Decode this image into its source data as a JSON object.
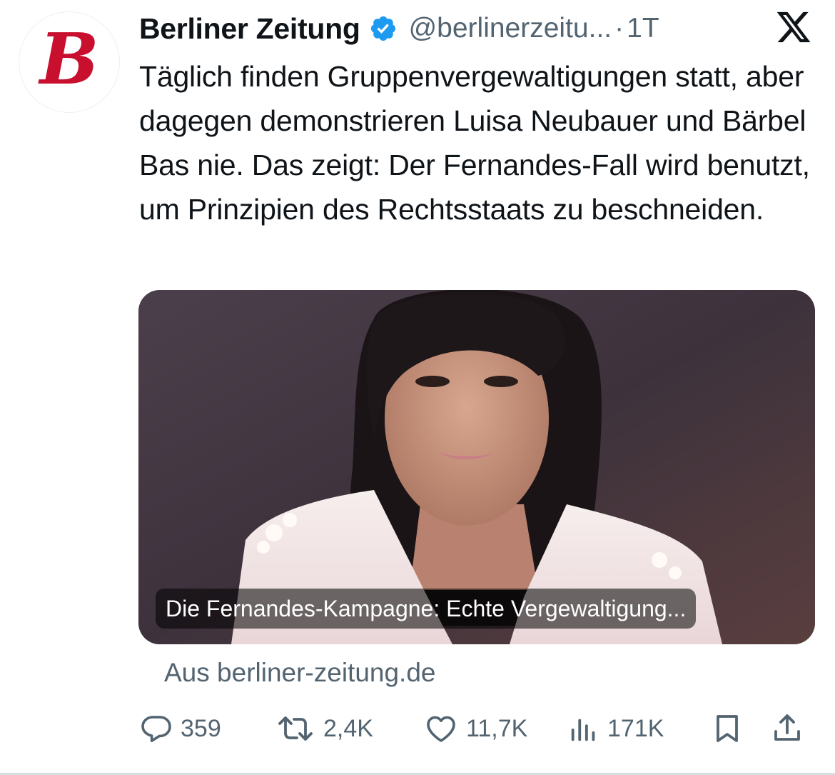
{
  "author": {
    "name": "Berliner Zeitung",
    "handle": "@berlinerzeitu...",
    "separator": "·",
    "time": "1T",
    "avatar_letter": "B",
    "verified_icon": "verified-badge-icon"
  },
  "platform_logo": "x-logo",
  "tweet_text": "Täglich finden Gruppenvergewaltigungen statt, aber dagegen demonstrieren Luisa Neubauer und Bärbel Bas nie. Das zeigt: Der Fernandes-Fall wird benutzt, um Prinzipien des Rechtsstaats zu beschneiden.",
  "card": {
    "title": "Die Fernandes-Kampagne: Echte Vergewaltigung...",
    "source": "Aus berliner-zeitung.de"
  },
  "actions": {
    "replies": "359",
    "reposts": "2,4K",
    "likes": "11,7K",
    "views": "171K"
  },
  "colors": {
    "verified": "#1d9bf0",
    "secondary_text": "#536471",
    "avatar_red": "#c8102e"
  }
}
